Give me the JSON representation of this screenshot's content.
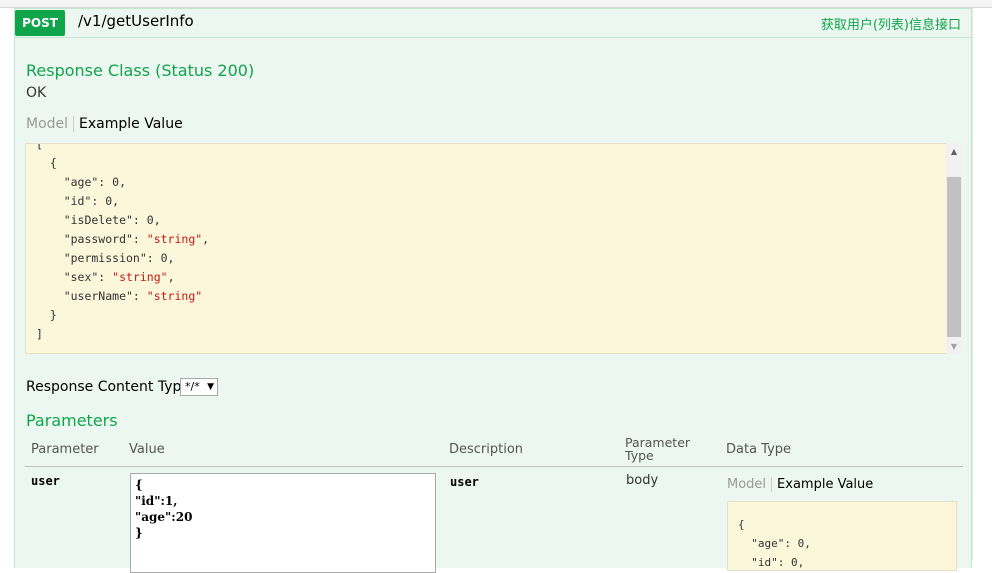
{
  "operation": {
    "method": "POST",
    "path": "/v1/getUserInfo",
    "summary": "获取用户(列表)信息接口"
  },
  "response_class": {
    "title": "Response Class (Status 200)",
    "status_text": "OK",
    "tab_model": "Model",
    "tab_example": "Example Value",
    "example_lines": [
      "[",
      "  {",
      "    \"age\": 0,",
      "    \"id\": 0,",
      "    \"isDelete\": 0,",
      "    \"password\": \"string\",",
      "    \"permission\": 0,",
      "    \"sex\": \"string\",",
      "    \"userName\": \"string\"",
      "  }",
      "]"
    ]
  },
  "content_type": {
    "label": "Response Content Type",
    "selected": "*/*"
  },
  "parameters": {
    "title": "Parameters",
    "headers": {
      "parameter": "Parameter",
      "value": "Value",
      "description": "Description",
      "parameter_type": "Parameter Type",
      "data_type": "Data Type"
    },
    "rows": [
      {
        "name": "user",
        "value_lines": [
          "{",
          "\"id\":1,",
          "\"age\":20",
          "}"
        ],
        "description": "user",
        "param_type": "body",
        "data_tab_model": "Model",
        "data_tab_example": "Example Value",
        "data_example_lines": [
          "{",
          "  \"age\": 0,",
          "  \"id\": 0,"
        ]
      }
    ]
  },
  "colors": {
    "post_green": "#10a54a",
    "panel_bg": "#ebf7f0",
    "code_bg": "#fcf6db"
  }
}
